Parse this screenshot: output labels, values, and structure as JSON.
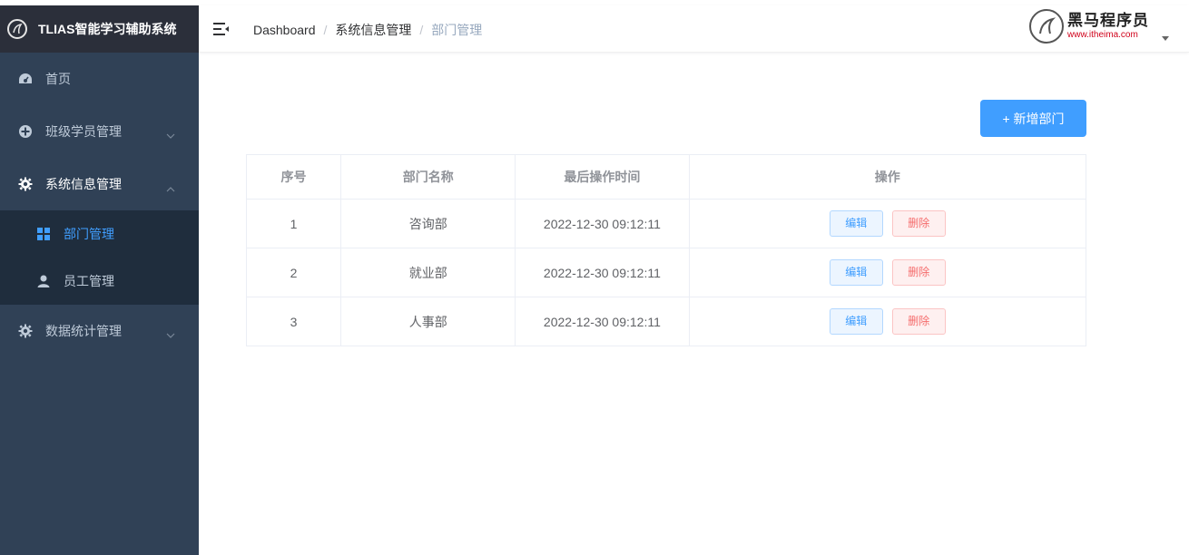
{
  "app": {
    "title": "TLIAS智能学习辅助系统"
  },
  "sidebar": {
    "items": [
      {
        "label": "首页",
        "icon": "dashboard-icon"
      },
      {
        "label": "班级学员管理",
        "icon": "plus-circle-icon",
        "expanded": false
      },
      {
        "label": "系统信息管理",
        "icon": "gear-icon",
        "expanded": true,
        "children": [
          {
            "label": "部门管理",
            "icon": "grid-icon",
            "active": true
          },
          {
            "label": "员工管理",
            "icon": "user-icon",
            "active": false
          }
        ]
      },
      {
        "label": "数据统计管理",
        "icon": "gear-icon",
        "expanded": false
      }
    ]
  },
  "header": {
    "breadcrumb": [
      "Dashboard",
      "系统信息管理",
      "部门管理"
    ],
    "logo": {
      "name": "黑马程序员",
      "url": "www.itheima.com"
    }
  },
  "toolbar": {
    "add_label": "+ 新增部门"
  },
  "table": {
    "columns": [
      "序号",
      "部门名称",
      "最后操作时间",
      "操作"
    ],
    "rows": [
      {
        "index": "1",
        "name": "咨询部",
        "updated": "2022-12-30 09:12:11"
      },
      {
        "index": "2",
        "name": "就业部",
        "updated": "2022-12-30 09:12:11"
      },
      {
        "index": "3",
        "name": "人事部",
        "updated": "2022-12-30 09:12:11"
      }
    ],
    "edit_label": "编辑",
    "delete_label": "删除"
  },
  "colors": {
    "sidebar_bg": "#304156",
    "submenu_bg": "#1f2d3d",
    "accent": "#409eff",
    "danger": "#f56c6c"
  }
}
